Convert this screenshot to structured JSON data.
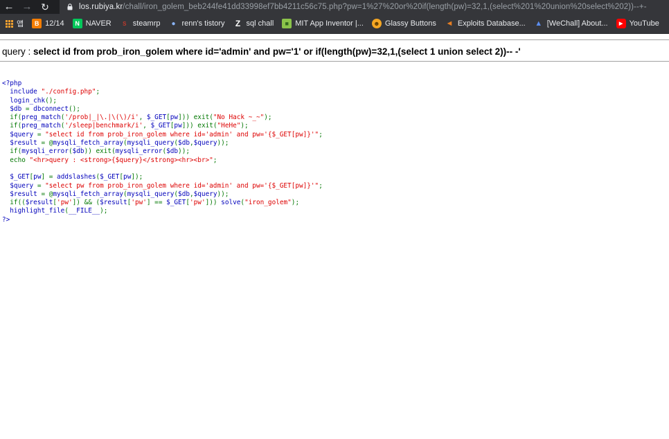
{
  "browser": {
    "back_icon": "arrow-left-icon",
    "forward_icon": "arrow-right-icon",
    "reload_icon": "reload-icon",
    "url_host": "los.rubiya.kr",
    "url_path": "/chall/iron_golem_beb244fe41dd33998ef7bb4211c56c75.php?pw=1%27%20or%20if(length(pw)=32,1,(select%201%20union%20select%202))--+-"
  },
  "bookmarks": [
    {
      "label": "앱",
      "icon": "apps-grid-icon"
    },
    {
      "label": "12/14",
      "icon": "blogger-icon",
      "color": "#f57d00"
    },
    {
      "label": "NAVER",
      "icon": "naver-icon",
      "color": "#03c75a"
    },
    {
      "label": "steamrp",
      "icon": "steamrp-icon",
      "color": "#c0392b"
    },
    {
      "label": "renn's tistory",
      "icon": "tistory-icon",
      "color": "#4a90d9"
    },
    {
      "label": "sql chall",
      "icon": "z-icon",
      "color": "#ffffff"
    },
    {
      "label": "MIT App Inventor |...",
      "icon": "app-inventor-icon",
      "color": "#8bc34a"
    },
    {
      "label": "Glassy Buttons",
      "icon": "glassy-icon",
      "color": "#f5a623"
    },
    {
      "label": "Exploits Database...",
      "icon": "exploit-db-icon",
      "color": "#e67e22"
    },
    {
      "label": "[WeChall] About...",
      "icon": "wechall-icon",
      "color": "#3f6fd8"
    },
    {
      "label": "YouTube",
      "icon": "youtube-icon",
      "color": "#ff0000"
    }
  ],
  "page": {
    "query_label": "query : ",
    "query_text": "select id from prob_iron_golem where id='admin' and pw='1' or if(length(pw)=32,1,(select 1 union select 2))-- -'"
  },
  "code_lines": [
    [
      {
        "c": "blue",
        "t": "<?php"
      }
    ],
    [
      {
        "c": "blue",
        "t": "  include "
      },
      {
        "c": "red",
        "t": "\"./config.php\""
      },
      {
        "c": "green",
        "t": ";"
      }
    ],
    [
      {
        "c": "blue",
        "t": "  login_chk"
      },
      {
        "c": "green",
        "t": "();"
      }
    ],
    [
      {
        "c": "blue",
        "t": "  $db "
      },
      {
        "c": "green",
        "t": "= "
      },
      {
        "c": "blue",
        "t": "dbconnect"
      },
      {
        "c": "green",
        "t": "();"
      }
    ],
    [
      {
        "c": "green",
        "t": "  if("
      },
      {
        "c": "blue",
        "t": "preg_match"
      },
      {
        "c": "green",
        "t": "("
      },
      {
        "c": "red",
        "t": "'/prob|_|\\.|\\(\\)/i'"
      },
      {
        "c": "green",
        "t": ", "
      },
      {
        "c": "blue",
        "t": "$_GET"
      },
      {
        "c": "green",
        "t": "["
      },
      {
        "c": "blue",
        "t": "pw"
      },
      {
        "c": "green",
        "t": "])) exit("
      },
      {
        "c": "red",
        "t": "\"No Hack ~_~\""
      },
      {
        "c": "green",
        "t": ");"
      }
    ],
    [
      {
        "c": "green",
        "t": "  if("
      },
      {
        "c": "blue",
        "t": "preg_match"
      },
      {
        "c": "green",
        "t": "("
      },
      {
        "c": "red",
        "t": "'/sleep|benchmark/i'"
      },
      {
        "c": "green",
        "t": ", "
      },
      {
        "c": "blue",
        "t": "$_GET"
      },
      {
        "c": "green",
        "t": "["
      },
      {
        "c": "blue",
        "t": "pw"
      },
      {
        "c": "green",
        "t": "])) exit("
      },
      {
        "c": "red",
        "t": "\"HeHe\""
      },
      {
        "c": "green",
        "t": ");"
      }
    ],
    [
      {
        "c": "blue",
        "t": "  $query "
      },
      {
        "c": "green",
        "t": "= "
      },
      {
        "c": "red",
        "t": "\"select id from prob_iron_golem where id='admin' and pw='{$_GET[pw]}'\""
      },
      {
        "c": "green",
        "t": ";"
      }
    ],
    [
      {
        "c": "blue",
        "t": "  $result "
      },
      {
        "c": "green",
        "t": "= @"
      },
      {
        "c": "blue",
        "t": "mysqli_fetch_array"
      },
      {
        "c": "green",
        "t": "("
      },
      {
        "c": "blue",
        "t": "mysqli_query"
      },
      {
        "c": "green",
        "t": "("
      },
      {
        "c": "blue",
        "t": "$db"
      },
      {
        "c": "green",
        "t": ","
      },
      {
        "c": "blue",
        "t": "$query"
      },
      {
        "c": "green",
        "t": "));"
      }
    ],
    [
      {
        "c": "green",
        "t": "  if("
      },
      {
        "c": "blue",
        "t": "mysqli_error"
      },
      {
        "c": "green",
        "t": "("
      },
      {
        "c": "blue",
        "t": "$db"
      },
      {
        "c": "green",
        "t": ")) exit("
      },
      {
        "c": "blue",
        "t": "mysqli_error"
      },
      {
        "c": "green",
        "t": "("
      },
      {
        "c": "blue",
        "t": "$db"
      },
      {
        "c": "green",
        "t": "));"
      }
    ],
    [
      {
        "c": "green",
        "t": "  echo "
      },
      {
        "c": "red",
        "t": "\"<hr>query : <strong>{$query}</strong><hr><br>\""
      },
      {
        "c": "green",
        "t": ";"
      }
    ],
    [
      {
        "c": "blue",
        "t": ""
      }
    ],
    [
      {
        "c": "blue",
        "t": "  $_GET"
      },
      {
        "c": "green",
        "t": "["
      },
      {
        "c": "blue",
        "t": "pw"
      },
      {
        "c": "green",
        "t": "] = "
      },
      {
        "c": "blue",
        "t": "addslashes"
      },
      {
        "c": "green",
        "t": "("
      },
      {
        "c": "blue",
        "t": "$_GET"
      },
      {
        "c": "green",
        "t": "["
      },
      {
        "c": "blue",
        "t": "pw"
      },
      {
        "c": "green",
        "t": "]);"
      }
    ],
    [
      {
        "c": "blue",
        "t": "  $query "
      },
      {
        "c": "green",
        "t": "= "
      },
      {
        "c": "red",
        "t": "\"select pw from prob_iron_golem where id='admin' and pw='{$_GET[pw]}'\""
      },
      {
        "c": "green",
        "t": ";"
      }
    ],
    [
      {
        "c": "blue",
        "t": "  $result "
      },
      {
        "c": "green",
        "t": "= @"
      },
      {
        "c": "blue",
        "t": "mysqli_fetch_array"
      },
      {
        "c": "green",
        "t": "("
      },
      {
        "c": "blue",
        "t": "mysqli_query"
      },
      {
        "c": "green",
        "t": "("
      },
      {
        "c": "blue",
        "t": "$db"
      },
      {
        "c": "green",
        "t": ","
      },
      {
        "c": "blue",
        "t": "$query"
      },
      {
        "c": "green",
        "t": "));"
      }
    ],
    [
      {
        "c": "green",
        "t": "  if(("
      },
      {
        "c": "blue",
        "t": "$result"
      },
      {
        "c": "green",
        "t": "["
      },
      {
        "c": "red",
        "t": "'pw'"
      },
      {
        "c": "green",
        "t": "]) && ("
      },
      {
        "c": "blue",
        "t": "$result"
      },
      {
        "c": "green",
        "t": "["
      },
      {
        "c": "red",
        "t": "'pw'"
      },
      {
        "c": "green",
        "t": "] == "
      },
      {
        "c": "blue",
        "t": "$_GET"
      },
      {
        "c": "green",
        "t": "["
      },
      {
        "c": "red",
        "t": "'pw'"
      },
      {
        "c": "green",
        "t": "])) "
      },
      {
        "c": "blue",
        "t": "solve"
      },
      {
        "c": "green",
        "t": "("
      },
      {
        "c": "red",
        "t": "\"iron_golem\""
      },
      {
        "c": "green",
        "t": ");"
      }
    ],
    [
      {
        "c": "blue",
        "t": "  highlight_file"
      },
      {
        "c": "green",
        "t": "("
      },
      {
        "c": "blue",
        "t": "__FILE__"
      },
      {
        "c": "green",
        "t": ");"
      }
    ],
    [
      {
        "c": "blue",
        "t": "?>"
      }
    ]
  ]
}
